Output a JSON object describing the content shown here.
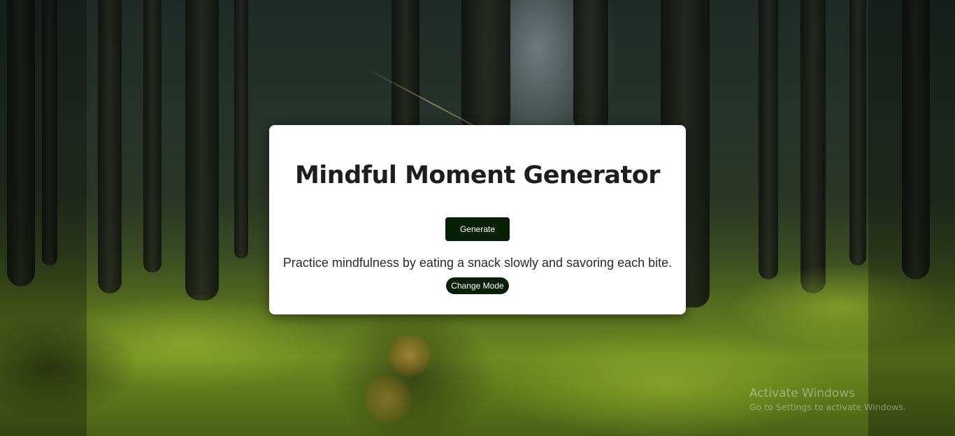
{
  "card": {
    "title": "Mindful Moment Generator",
    "generate_label": "Generate",
    "tip_text": "Practice mindfulness by eating a snack slowly and savoring each bite.",
    "change_mode_label": "Change Mode"
  },
  "watermark": {
    "title": "Activate Windows",
    "subtitle": "Go to Settings to activate Windows."
  },
  "colors": {
    "button_bg": "#052005",
    "card_bg": "#ffffff",
    "title_color": "#1e1e1e"
  }
}
